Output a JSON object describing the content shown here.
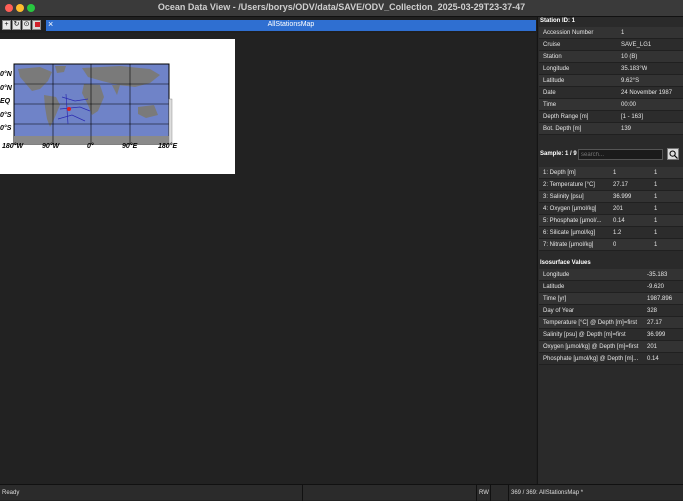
{
  "window": {
    "title": "Ocean Data View - /Users/borys/ODV/data/SAVE/ODV_Collection_2025-03-29T23-37-47"
  },
  "toolbar": {
    "buttons": [
      "add-icon",
      "reload-icon",
      "zoom-icon",
      "flag-icon"
    ]
  },
  "canvas": {
    "tab_title": "AllStationsMap",
    "close_label": "×",
    "map": {
      "lat_labels": [
        "0°N",
        "0°N",
        "EQ",
        "0°S",
        "0°S"
      ],
      "lon_labels": [
        "180°W",
        "90°W",
        "0°",
        "90°E",
        "180°E"
      ],
      "station_color": "#e02020",
      "ocean_color": "#6f83c8",
      "land_color": "#7a7a7a"
    }
  },
  "station": {
    "header": "Station ID: 1",
    "rows": [
      {
        "key": "Accession Number",
        "value": "1"
      },
      {
        "key": "Cruise",
        "value": "SAVE_LG1"
      },
      {
        "key": "Station",
        "value": "10 (B)"
      },
      {
        "key": "Longitude",
        "value": "35.183°W"
      },
      {
        "key": "Latitude",
        "value": "9.62°S"
      },
      {
        "key": "Date",
        "value": "24 November 1987"
      },
      {
        "key": "Time",
        "value": "00:00"
      },
      {
        "key": "Depth Range [m]",
        "value": "[1 - 163]"
      },
      {
        "key": "Bot. Depth [m]",
        "value": "139"
      }
    ]
  },
  "sample": {
    "label": "Sample: 1 / 9",
    "search_placeholder": "search...",
    "rows": [
      {
        "key": "1: Depth [m]",
        "value": "1",
        "flag": "1"
      },
      {
        "key": "2: Temperature [°C]",
        "value": "27.17",
        "flag": "1"
      },
      {
        "key": "3: Salinity [psu]",
        "value": "36.999",
        "flag": "1"
      },
      {
        "key": "4: Oxygen [µmol/kg]",
        "value": "201",
        "flag": "1"
      },
      {
        "key": "5: Phosphate [µmol/...",
        "value": "0.14",
        "flag": "1"
      },
      {
        "key": "6: Silicate [µmol/kg]",
        "value": "1.2",
        "flag": "1"
      },
      {
        "key": "7: Nitrate [µmol/kg]",
        "value": "0",
        "flag": "1"
      }
    ]
  },
  "isosurface": {
    "header": "Isosurface Values",
    "rows": [
      {
        "key": "Longitude",
        "value": "-35.183"
      },
      {
        "key": "Latitude",
        "value": "-9.620"
      },
      {
        "key": "Time [yr]",
        "value": "1987.896"
      },
      {
        "key": "Day of Year",
        "value": "328"
      },
      {
        "key": "Temperature [°C] @ Depth [m]=first",
        "value": "27.17"
      },
      {
        "key": "Salinity [psu] @ Depth [m]=first",
        "value": "36.999"
      },
      {
        "key": "Oxygen [µmol/kg] @ Depth [m]=first",
        "value": "201"
      },
      {
        "key": "Phosphate [µmol/kg] @ Depth [m]...",
        "value": "0.14"
      }
    ]
  },
  "status": {
    "left": "Ready",
    "mode": "RW",
    "right": "369 / 369: AllStationsMap *"
  }
}
